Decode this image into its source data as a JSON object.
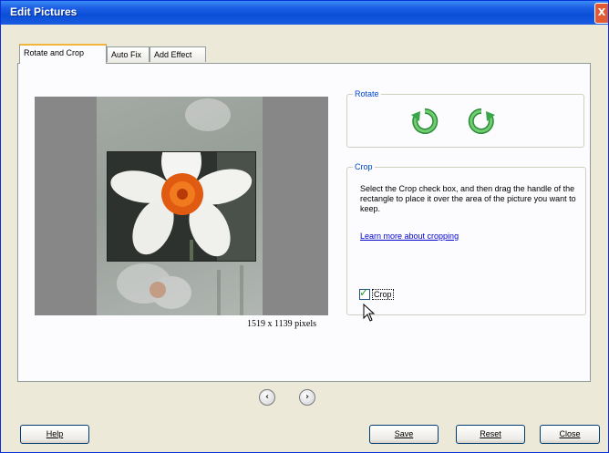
{
  "window": {
    "title": "Edit Pictures",
    "close_label": "X"
  },
  "tabs": [
    {
      "label": "Rotate and Crop",
      "active": true
    },
    {
      "label": "Auto Fix",
      "active": false
    },
    {
      "label": "Add Effect",
      "active": false
    }
  ],
  "preview": {
    "dimensions": "1519 x 1139 pixels"
  },
  "rotate": {
    "legend": "Rotate",
    "left_icon": "rotate-left-icon",
    "right_icon": "rotate-right-icon",
    "icon_color": "#3aa64a"
  },
  "crop": {
    "legend": "Crop",
    "instructions": "Select the Crop check box, and then drag the handle of the rectangle to place it over the area of the picture you want to keep.",
    "learn_more": "Learn more about cropping",
    "checkbox_label": "Crop",
    "checked": true
  },
  "navigation": {
    "prev_icon": "previous-arrow-icon",
    "next_icon": "next-arrow-icon"
  },
  "buttons": {
    "help": "Help",
    "save": "Save",
    "reset": "Reset",
    "close": "Close"
  },
  "colors": {
    "title_bar": "#0a4fd6",
    "tab_highlight": "#f1b53b",
    "legend_text": "#0046d5",
    "link": "#0000cc"
  }
}
